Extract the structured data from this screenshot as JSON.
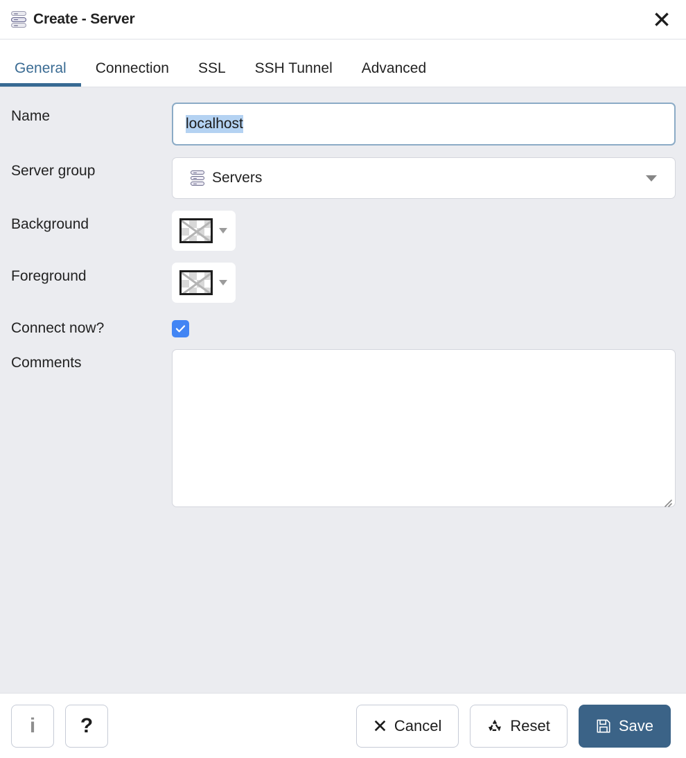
{
  "window": {
    "title": "Create - Server",
    "title_icon": "server-stack-icon",
    "close_icon": "close-icon"
  },
  "tabs": {
    "active": "General",
    "items": [
      {
        "label": "General",
        "active": true
      },
      {
        "label": "Connection",
        "active": false
      },
      {
        "label": "SSL",
        "active": false
      },
      {
        "label": "SSH Tunnel",
        "active": false
      },
      {
        "label": "Advanced",
        "active": false
      }
    ]
  },
  "form": {
    "name": {
      "label": "Name",
      "value": "localhost",
      "placeholder": "",
      "selected": true
    },
    "server_group": {
      "label": "Server group",
      "value": "Servers",
      "icon": "server-stack-icon",
      "caret_icon": "chevron-down-icon"
    },
    "background": {
      "label": "Background",
      "value": "",
      "swatch": "transparent-checkerboard",
      "caret_icon": "chevron-down-icon"
    },
    "foreground": {
      "label": "Foreground",
      "value": "",
      "swatch": "transparent-checkerboard",
      "caret_icon": "chevron-down-icon"
    },
    "connect_now": {
      "label": "Connect now?",
      "checked": true,
      "check_icon": "checkmark-icon"
    },
    "comments": {
      "label": "Comments",
      "value": "",
      "placeholder": ""
    }
  },
  "footer": {
    "info_label": "i",
    "info_icon": "info-icon",
    "help_label": "?",
    "help_icon": "question-mark-icon",
    "cancel_label": "Cancel",
    "cancel_icon": "close-x-icon",
    "reset_label": "Reset",
    "reset_icon": "recycle-icon",
    "save_label": "Save",
    "save_icon": "floppy-disk-icon"
  },
  "colors": {
    "accent": "#376a93",
    "primary_button": "#3b6387",
    "checkbox": "#4285f4",
    "selection": "#b4d2f2",
    "body_background": "#ebecf0",
    "panel": "#ffffff",
    "border": "#dfe1e6",
    "text": "#222222"
  }
}
